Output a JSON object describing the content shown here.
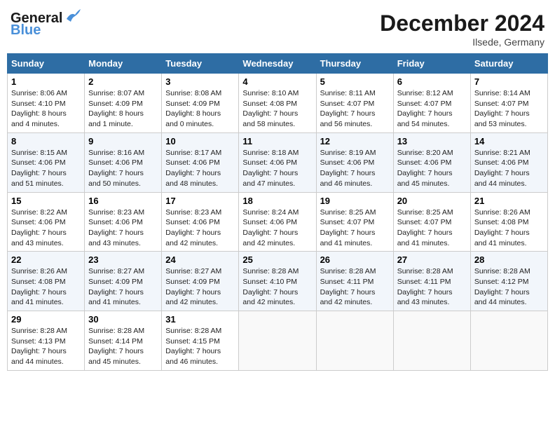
{
  "header": {
    "logo_line1": "General",
    "logo_line2": "Blue",
    "month": "December 2024",
    "location": "Ilsede, Germany"
  },
  "days_of_week": [
    "Sunday",
    "Monday",
    "Tuesday",
    "Wednesday",
    "Thursday",
    "Friday",
    "Saturday"
  ],
  "weeks": [
    [
      {
        "day": "1",
        "sunrise": "Sunrise: 8:06 AM",
        "sunset": "Sunset: 4:10 PM",
        "daylight": "Daylight: 8 hours and 4 minutes."
      },
      {
        "day": "2",
        "sunrise": "Sunrise: 8:07 AM",
        "sunset": "Sunset: 4:09 PM",
        "daylight": "Daylight: 8 hours and 1 minute."
      },
      {
        "day": "3",
        "sunrise": "Sunrise: 8:08 AM",
        "sunset": "Sunset: 4:09 PM",
        "daylight": "Daylight: 8 hours and 0 minutes."
      },
      {
        "day": "4",
        "sunrise": "Sunrise: 8:10 AM",
        "sunset": "Sunset: 4:08 PM",
        "daylight": "Daylight: 7 hours and 58 minutes."
      },
      {
        "day": "5",
        "sunrise": "Sunrise: 8:11 AM",
        "sunset": "Sunset: 4:07 PM",
        "daylight": "Daylight: 7 hours and 56 minutes."
      },
      {
        "day": "6",
        "sunrise": "Sunrise: 8:12 AM",
        "sunset": "Sunset: 4:07 PM",
        "daylight": "Daylight: 7 hours and 54 minutes."
      },
      {
        "day": "7",
        "sunrise": "Sunrise: 8:14 AM",
        "sunset": "Sunset: 4:07 PM",
        "daylight": "Daylight: 7 hours and 53 minutes."
      }
    ],
    [
      {
        "day": "8",
        "sunrise": "Sunrise: 8:15 AM",
        "sunset": "Sunset: 4:06 PM",
        "daylight": "Daylight: 7 hours and 51 minutes."
      },
      {
        "day": "9",
        "sunrise": "Sunrise: 8:16 AM",
        "sunset": "Sunset: 4:06 PM",
        "daylight": "Daylight: 7 hours and 50 minutes."
      },
      {
        "day": "10",
        "sunrise": "Sunrise: 8:17 AM",
        "sunset": "Sunset: 4:06 PM",
        "daylight": "Daylight: 7 hours and 48 minutes."
      },
      {
        "day": "11",
        "sunrise": "Sunrise: 8:18 AM",
        "sunset": "Sunset: 4:06 PM",
        "daylight": "Daylight: 7 hours and 47 minutes."
      },
      {
        "day": "12",
        "sunrise": "Sunrise: 8:19 AM",
        "sunset": "Sunset: 4:06 PM",
        "daylight": "Daylight: 7 hours and 46 minutes."
      },
      {
        "day": "13",
        "sunrise": "Sunrise: 8:20 AM",
        "sunset": "Sunset: 4:06 PM",
        "daylight": "Daylight: 7 hours and 45 minutes."
      },
      {
        "day": "14",
        "sunrise": "Sunrise: 8:21 AM",
        "sunset": "Sunset: 4:06 PM",
        "daylight": "Daylight: 7 hours and 44 minutes."
      }
    ],
    [
      {
        "day": "15",
        "sunrise": "Sunrise: 8:22 AM",
        "sunset": "Sunset: 4:06 PM",
        "daylight": "Daylight: 7 hours and 43 minutes."
      },
      {
        "day": "16",
        "sunrise": "Sunrise: 8:23 AM",
        "sunset": "Sunset: 4:06 PM",
        "daylight": "Daylight: 7 hours and 43 minutes."
      },
      {
        "day": "17",
        "sunrise": "Sunrise: 8:23 AM",
        "sunset": "Sunset: 4:06 PM",
        "daylight": "Daylight: 7 hours and 42 minutes."
      },
      {
        "day": "18",
        "sunrise": "Sunrise: 8:24 AM",
        "sunset": "Sunset: 4:06 PM",
        "daylight": "Daylight: 7 hours and 42 minutes."
      },
      {
        "day": "19",
        "sunrise": "Sunrise: 8:25 AM",
        "sunset": "Sunset: 4:07 PM",
        "daylight": "Daylight: 7 hours and 41 minutes."
      },
      {
        "day": "20",
        "sunrise": "Sunrise: 8:25 AM",
        "sunset": "Sunset: 4:07 PM",
        "daylight": "Daylight: 7 hours and 41 minutes."
      },
      {
        "day": "21",
        "sunrise": "Sunrise: 8:26 AM",
        "sunset": "Sunset: 4:08 PM",
        "daylight": "Daylight: 7 hours and 41 minutes."
      }
    ],
    [
      {
        "day": "22",
        "sunrise": "Sunrise: 8:26 AM",
        "sunset": "Sunset: 4:08 PM",
        "daylight": "Daylight: 7 hours and 41 minutes."
      },
      {
        "day": "23",
        "sunrise": "Sunrise: 8:27 AM",
        "sunset": "Sunset: 4:09 PM",
        "daylight": "Daylight: 7 hours and 41 minutes."
      },
      {
        "day": "24",
        "sunrise": "Sunrise: 8:27 AM",
        "sunset": "Sunset: 4:09 PM",
        "daylight": "Daylight: 7 hours and 42 minutes."
      },
      {
        "day": "25",
        "sunrise": "Sunrise: 8:28 AM",
        "sunset": "Sunset: 4:10 PM",
        "daylight": "Daylight: 7 hours and 42 minutes."
      },
      {
        "day": "26",
        "sunrise": "Sunrise: 8:28 AM",
        "sunset": "Sunset: 4:11 PM",
        "daylight": "Daylight: 7 hours and 42 minutes."
      },
      {
        "day": "27",
        "sunrise": "Sunrise: 8:28 AM",
        "sunset": "Sunset: 4:11 PM",
        "daylight": "Daylight: 7 hours and 43 minutes."
      },
      {
        "day": "28",
        "sunrise": "Sunrise: 8:28 AM",
        "sunset": "Sunset: 4:12 PM",
        "daylight": "Daylight: 7 hours and 44 minutes."
      }
    ],
    [
      {
        "day": "29",
        "sunrise": "Sunrise: 8:28 AM",
        "sunset": "Sunset: 4:13 PM",
        "daylight": "Daylight: 7 hours and 44 minutes."
      },
      {
        "day": "30",
        "sunrise": "Sunrise: 8:28 AM",
        "sunset": "Sunset: 4:14 PM",
        "daylight": "Daylight: 7 hours and 45 minutes."
      },
      {
        "day": "31",
        "sunrise": "Sunrise: 8:28 AM",
        "sunset": "Sunset: 4:15 PM",
        "daylight": "Daylight: 7 hours and 46 minutes."
      },
      null,
      null,
      null,
      null
    ]
  ]
}
